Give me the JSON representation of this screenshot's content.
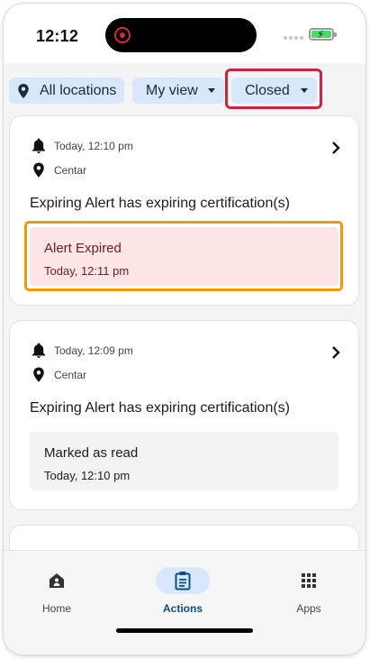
{
  "status_bar": {
    "time": "12:12",
    "battery_icon": "battery-charging-icon"
  },
  "filters": {
    "locations_label": "All locations",
    "view_label": "My view",
    "status_label": "Closed"
  },
  "cards": [
    {
      "time": "Today, 12:10 pm",
      "location": "Centar",
      "title": "Expiring Alert has expiring certification(s)",
      "status_title": "Alert Expired",
      "status_time": "Today, 12:11 pm"
    },
    {
      "time": "Today, 12:09 pm",
      "location": "Centar",
      "title": "Expiring Alert has expiring certification(s)",
      "status_title": "Marked as read",
      "status_time": "Today, 12:10 pm"
    }
  ],
  "nav": {
    "home": "Home",
    "actions": "Actions",
    "apps": "Apps"
  },
  "colors": {
    "chip_bg": "#d8e7fb",
    "highlight_red": "#c3283d",
    "highlight_orange": "#f2990a",
    "expired_bg": "#fde5e5",
    "nav_active": "#0d4d8c"
  }
}
